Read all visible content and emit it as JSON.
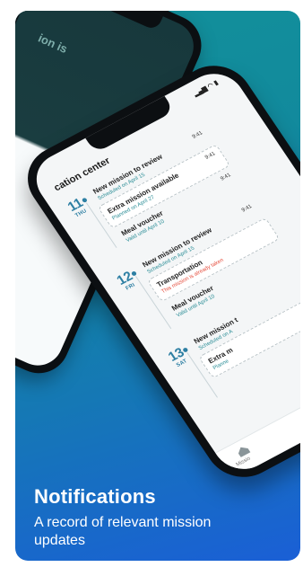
{
  "caption": {
    "title": "Notifications",
    "subtitle": "A record of relevant mission updates"
  },
  "back_phone": {
    "promo_text": "ion is"
  },
  "front_phone": {
    "header": "cation center",
    "status_time": "",
    "days": [
      {
        "num": "11",
        "dow": "THU",
        "items": [
          {
            "title": "New mission to review",
            "sub": "Scheduled on April 15",
            "time": "9:41",
            "style": "plain"
          },
          {
            "title": "Extra mission available",
            "sub": "Planned on April 27",
            "time": "9:41",
            "style": "boxed"
          },
          {
            "title": "Meal voucher",
            "sub": "Valid until April 10",
            "time": "9:41",
            "style": "plain"
          }
        ]
      },
      {
        "num": "12",
        "dow": "FRI",
        "items": [
          {
            "title": "New mission to review",
            "sub": "Scheduled on April 15",
            "time": "9:41",
            "style": "plain"
          },
          {
            "title": "Transportation",
            "sub": "This mission is already taken",
            "time": "",
            "style": "boxed",
            "alert": true
          },
          {
            "title": "Meal voucher",
            "sub": "Valid until April 10",
            "time": "",
            "style": "plain"
          }
        ]
      },
      {
        "num": "13",
        "dow": "SAT",
        "items": [
          {
            "title": "New mission t",
            "sub": "Scheduled on A",
            "time": "",
            "style": "plain"
          },
          {
            "title": "Extra m",
            "sub": "Planne",
            "time": "",
            "style": "boxed"
          }
        ]
      }
    ],
    "tabbar": {
      "label": "Missio"
    }
  },
  "colors": {
    "gradient_top": "#12909a",
    "gradient_bottom": "#1a5fd6",
    "accent": "#2d7fa3",
    "alert": "#e54b3a"
  }
}
